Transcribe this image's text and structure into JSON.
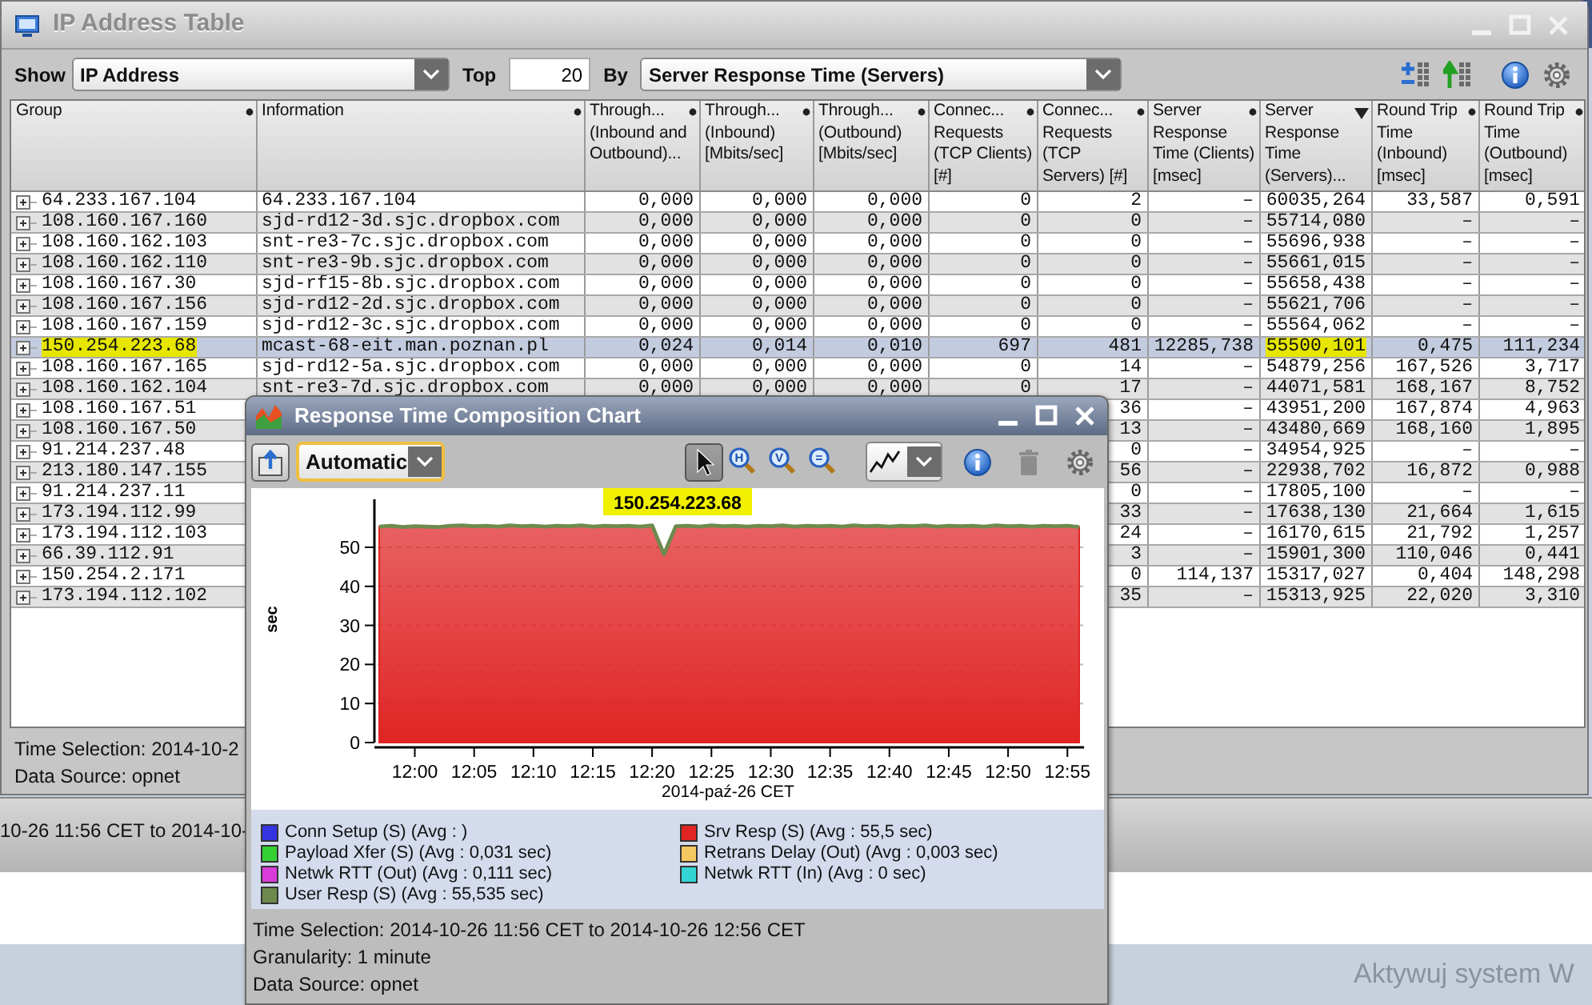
{
  "background_window": {
    "footer_text": "10-26 11:56 CET to 2014-10-"
  },
  "os_notice": {
    "text": "Aktywuj system W"
  },
  "main_window": {
    "title": "IP Address Table",
    "active": false,
    "toolbar": {
      "show_label": "Show",
      "show_value": "IP Address",
      "top_label": "Top",
      "top_value": "20",
      "by_label": "By",
      "by_value": "Server Response Time (Servers)"
    },
    "columns": [
      {
        "label": "Group",
        "sorted": false
      },
      {
        "label": "Information",
        "sorted": false
      },
      {
        "label": "Through... (Inbound and Outbound)...",
        "sorted": false
      },
      {
        "label": "Through... (Inbound) [Mbits/sec]",
        "sorted": false
      },
      {
        "label": "Through... (Outbound) [Mbits/sec]",
        "sorted": false
      },
      {
        "label": "Connec... Requests (TCP Clients) [#]",
        "sorted": false
      },
      {
        "label": "Connec... Requests (TCP Servers) [#]",
        "sorted": false
      },
      {
        "label": "Server Response Time (Clients) [msec]",
        "sorted": false
      },
      {
        "label": "Server Response Time (Servers)...",
        "sorted": true
      },
      {
        "label": "Round Trip Time (Inbound) [msec]",
        "sorted": false
      },
      {
        "label": "Round Trip Time (Outbound) [msec]",
        "sorted": false
      }
    ],
    "rows": [
      {
        "group": "64.233.167.104",
        "information": "64.233.167.104",
        "thr_in_out": "0,000",
        "thr_in": "0,000",
        "thr_out": "0,000",
        "req_clients": "0",
        "req_servers": "2",
        "srt_clients": "–",
        "srt_servers": "60035,264",
        "rtt_in": "33,587",
        "rtt_out": "0,591",
        "selected": false,
        "highlighted": false
      },
      {
        "group": "108.160.167.160",
        "information": "sjd-rd12-3d.sjc.dropbox.com",
        "thr_in_out": "0,000",
        "thr_in": "0,000",
        "thr_out": "0,000",
        "req_clients": "0",
        "req_servers": "0",
        "srt_clients": "–",
        "srt_servers": "55714,080",
        "rtt_in": "–",
        "rtt_out": "–",
        "selected": false,
        "highlighted": false
      },
      {
        "group": "108.160.162.103",
        "information": "snt-re3-7c.sjc.dropbox.com",
        "thr_in_out": "0,000",
        "thr_in": "0,000",
        "thr_out": "0,000",
        "req_clients": "0",
        "req_servers": "0",
        "srt_clients": "–",
        "srt_servers": "55696,938",
        "rtt_in": "–",
        "rtt_out": "–",
        "selected": false,
        "highlighted": false
      },
      {
        "group": "108.160.162.110",
        "information": "snt-re3-9b.sjc.dropbox.com",
        "thr_in_out": "0,000",
        "thr_in": "0,000",
        "thr_out": "0,000",
        "req_clients": "0",
        "req_servers": "0",
        "srt_clients": "–",
        "srt_servers": "55661,015",
        "rtt_in": "–",
        "rtt_out": "–",
        "selected": false,
        "highlighted": false
      },
      {
        "group": "108.160.167.30",
        "information": "sjd-rf15-8b.sjc.dropbox.com",
        "thr_in_out": "0,000",
        "thr_in": "0,000",
        "thr_out": "0,000",
        "req_clients": "0",
        "req_servers": "0",
        "srt_clients": "–",
        "srt_servers": "55658,438",
        "rtt_in": "–",
        "rtt_out": "–",
        "selected": false,
        "highlighted": false
      },
      {
        "group": "108.160.167.156",
        "information": "sjd-rd12-2d.sjc.dropbox.com",
        "thr_in_out": "0,000",
        "thr_in": "0,000",
        "thr_out": "0,000",
        "req_clients": "0",
        "req_servers": "0",
        "srt_clients": "–",
        "srt_servers": "55621,706",
        "rtt_in": "–",
        "rtt_out": "–",
        "selected": false,
        "highlighted": false
      },
      {
        "group": "108.160.167.159",
        "information": "sjd-rd12-3c.sjc.dropbox.com",
        "thr_in_out": "0,000",
        "thr_in": "0,000",
        "thr_out": "0,000",
        "req_clients": "0",
        "req_servers": "0",
        "srt_clients": "–",
        "srt_servers": "55564,062",
        "rtt_in": "–",
        "rtt_out": "–",
        "selected": false,
        "highlighted": false
      },
      {
        "group": "150.254.223.68",
        "information": "mcast-68-eit.man.poznan.pl",
        "thr_in_out": "0,024",
        "thr_in": "0,014",
        "thr_out": "0,010",
        "req_clients": "697",
        "req_servers": "481",
        "srt_clients": "12285,738",
        "srt_servers": "55500,101",
        "rtt_in": "0,475",
        "rtt_out": "111,234",
        "selected": true,
        "highlighted": true
      },
      {
        "group": "108.160.167.165",
        "information": "sjd-rd12-5a.sjc.dropbox.com",
        "thr_in_out": "0,000",
        "thr_in": "0,000",
        "thr_out": "0,000",
        "req_clients": "0",
        "req_servers": "14",
        "srt_clients": "–",
        "srt_servers": "54879,256",
        "rtt_in": "167,526",
        "rtt_out": "3,717",
        "selected": false,
        "highlighted": false
      },
      {
        "group": "108.160.162.104",
        "information": "snt-re3-7d.sjc.dropbox.com",
        "thr_in_out": "0,000",
        "thr_in": "0,000",
        "thr_out": "0,000",
        "req_clients": "0",
        "req_servers": "17",
        "srt_clients": "–",
        "srt_servers": "44071,581",
        "rtt_in": "168,167",
        "rtt_out": "8,752",
        "selected": false,
        "highlighted": false
      },
      {
        "group": "108.160.167.51",
        "req_servers": "36",
        "srt_clients": "–",
        "srt_servers": "43951,200",
        "rtt_in": "167,874",
        "rtt_out": "4,963",
        "selected": false,
        "highlighted": false
      },
      {
        "group": "108.160.167.50",
        "req_servers": "13",
        "srt_clients": "–",
        "srt_servers": "43480,669",
        "rtt_in": "168,160",
        "rtt_out": "1,895",
        "selected": false,
        "highlighted": false
      },
      {
        "group": "91.214.237.48",
        "req_servers": "0",
        "srt_clients": "–",
        "srt_servers": "34954,925",
        "rtt_in": "–",
        "rtt_out": "–",
        "selected": false,
        "highlighted": false
      },
      {
        "group": "213.180.147.155",
        "req_servers": "56",
        "srt_clients": "–",
        "srt_servers": "22938,702",
        "rtt_in": "16,872",
        "rtt_out": "0,988",
        "selected": false,
        "highlighted": false
      },
      {
        "group": "91.214.237.11",
        "req_servers": "0",
        "srt_clients": "–",
        "srt_servers": "17805,100",
        "rtt_in": "–",
        "rtt_out": "–",
        "selected": false,
        "highlighted": false
      },
      {
        "group": "173.194.112.99",
        "req_servers": "33",
        "srt_clients": "–",
        "srt_servers": "17638,130",
        "rtt_in": "21,664",
        "rtt_out": "1,615",
        "selected": false,
        "highlighted": false
      },
      {
        "group": "173.194.112.103",
        "req_servers": "24",
        "srt_clients": "–",
        "srt_servers": "16170,615",
        "rtt_in": "21,792",
        "rtt_out": "1,257",
        "selected": false,
        "highlighted": false
      },
      {
        "group": "66.39.112.91",
        "req_servers": "3",
        "srt_clients": "–",
        "srt_servers": "15901,300",
        "rtt_in": "110,046",
        "rtt_out": "0,441",
        "selected": false,
        "highlighted": false
      },
      {
        "group": "150.254.2.171",
        "req_servers": "0",
        "srt_clients": "114,137",
        "srt_servers": "15317,027",
        "rtt_in": "0,404",
        "rtt_out": "148,298",
        "selected": false,
        "highlighted": false
      },
      {
        "group": "173.194.112.102",
        "req_servers": "35",
        "srt_clients": "–",
        "srt_servers": "15313,925",
        "rtt_in": "22,020",
        "rtt_out": "3,310",
        "selected": false,
        "highlighted": false
      }
    ],
    "footer": [
      "Time Selection: 2014-10-2",
      "Data Source: opnet"
    ]
  },
  "chart_window": {
    "title": "Response Time Composition Chart",
    "toolbar": {
      "range_value": "Automatic",
      "tools": [
        {
          "kind": "pointer",
          "selected": true
        },
        {
          "kind": "zoom",
          "glyph": "H",
          "selected": false
        },
        {
          "kind": "zoom",
          "glyph": "V",
          "selected": false
        },
        {
          "kind": "zoom",
          "glyph": "=",
          "selected": false
        }
      ],
      "actions": [
        {
          "kind": "info",
          "disabled": false
        },
        {
          "kind": "delete",
          "disabled": true
        },
        {
          "kind": "settings",
          "disabled": false
        }
      ]
    },
    "chart_data": {
      "type": "area",
      "title": "150.254.223.68",
      "xlabel": "2014-paź-26 CET",
      "ylabel": "sec",
      "grid": true,
      "categories": [
        null,
        null,
        null,
        "12:00",
        null,
        null,
        null,
        null,
        "12:05",
        null,
        null,
        null,
        null,
        "12:10",
        null,
        null,
        null,
        null,
        "12:15",
        null,
        null,
        null,
        null,
        "12:20",
        null,
        null,
        null,
        null,
        "12:25",
        null,
        null,
        null,
        null,
        "12:30",
        null,
        null,
        null,
        null,
        "12:35",
        null,
        null,
        null,
        null,
        "12:40",
        null,
        null,
        null,
        null,
        "12:45",
        null,
        null,
        null,
        null,
        "12:50",
        null,
        null,
        null,
        null,
        "12:55",
        null
      ],
      "ylim": [
        0,
        62
      ],
      "yticks": [
        0,
        10,
        20,
        30,
        40,
        50
      ],
      "series": [
        {
          "color": "#e02424",
          "values": [
            55.3,
            55.5,
            55.2,
            55.4,
            55.3,
            55.2,
            55.5,
            55.6,
            55.4,
            55.5,
            55.3,
            55.6,
            55.4,
            55.5,
            55.3,
            55.5,
            55.4,
            55.6,
            55.3,
            55.5,
            55.4,
            55.5,
            55.3,
            55.6,
            48.2,
            55.4,
            55.5,
            55.3,
            55.6,
            55.4,
            55.5,
            55.3,
            55.5,
            55.4,
            55.6,
            55.3,
            55.5,
            55.4,
            55.5,
            55.3,
            55.6,
            55.4,
            55.5,
            55.3,
            55.5,
            55.4,
            55.6,
            55.3,
            55.5,
            55.4,
            55.5,
            55.3,
            55.6,
            55.4,
            55.5,
            55.3,
            55.5,
            55.4,
            55.5,
            55.2
          ]
        }
      ]
    },
    "legend": [
      {
        "label": "Conn Setup (S) (Avg : )",
        "color": "#3434e0"
      },
      {
        "label": "Srv Resp (S) (Avg : 55,5 sec)",
        "color": "#e02424"
      },
      {
        "label": "Payload Xfer (S) (Avg : 0,031 sec)",
        "color": "#34d034"
      },
      {
        "label": "Retrans Delay (Out) (Avg : 0,003 sec)",
        "color": "#f4c860"
      },
      {
        "label": "Netwk RTT (Out) (Avg : 0,111 sec)",
        "color": "#d83cd8"
      },
      {
        "label": "Netwk RTT (In) (Avg : 0 sec)",
        "color": "#34d4d4"
      },
      {
        "label": "User Resp (S) (Avg : 55,535 sec)",
        "color": "#6e8a4e"
      }
    ],
    "footer": [
      "Time Selection: 2014-10-26 11:56 CET to 2014-10-26 12:56 CET",
      "Granularity: 1 minute",
      "Data Source: opnet"
    ]
  }
}
